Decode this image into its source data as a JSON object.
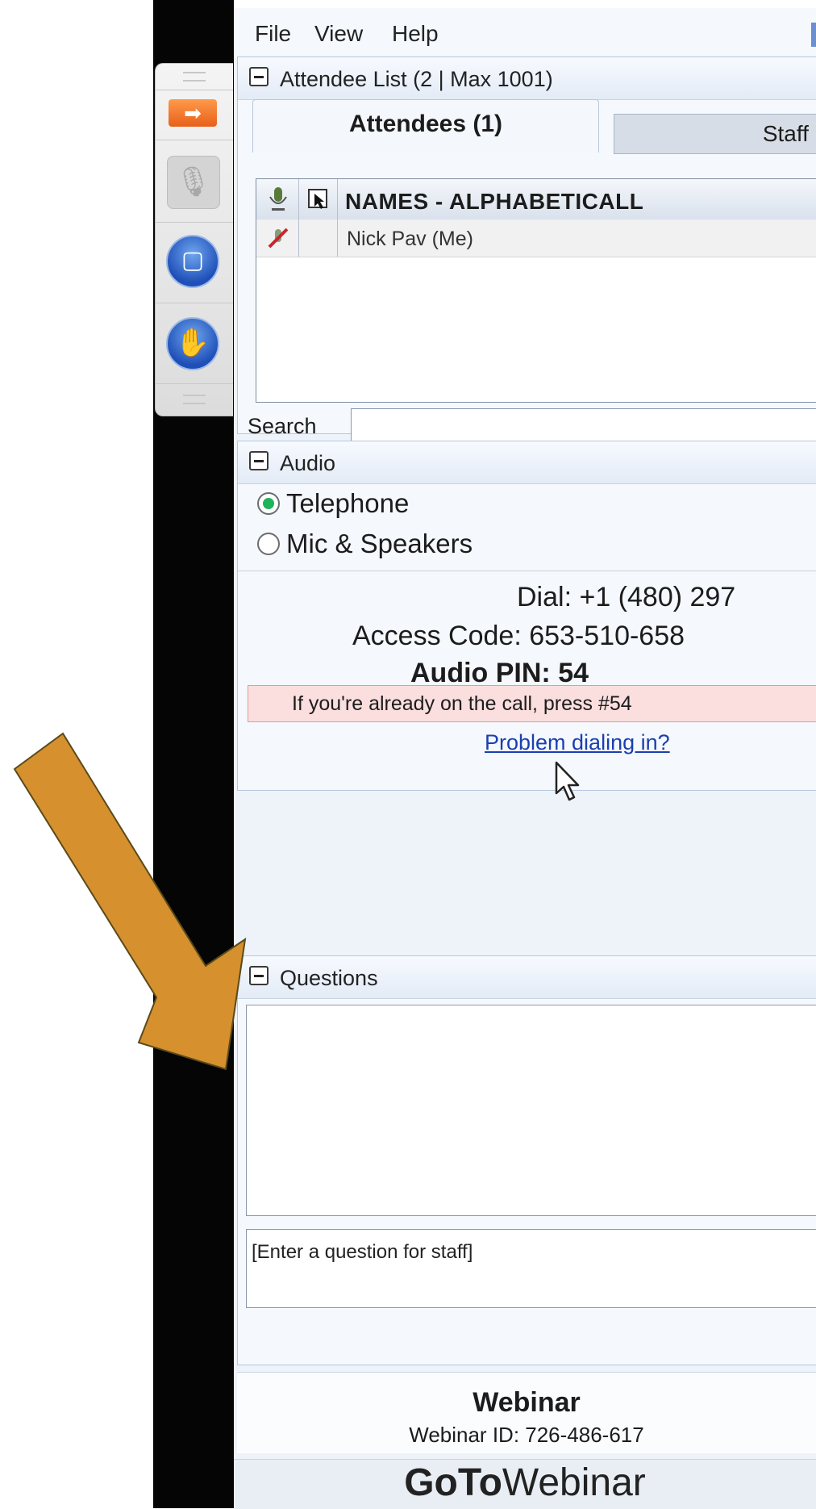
{
  "menu": {
    "file": "File",
    "view": "View",
    "help": "Help"
  },
  "attendee_panel": {
    "title": "Attendee List  (2 | Max 1001)",
    "tabs": {
      "attendees": "Attendees (1)",
      "staff": "Staff ("
    },
    "column_header": "NAMES - ALPHABETICALL",
    "rows": [
      {
        "name": "Nick Pav (Me)"
      }
    ],
    "search_label": "Search",
    "search_value": ""
  },
  "audio_panel": {
    "title": "Audio",
    "options": {
      "telephone": "Telephone",
      "mic_speakers": "Mic & Speakers"
    },
    "selected": "telephone",
    "dial": "Dial: +1 (480) 297",
    "access_code": "Access Code: 653-510-658",
    "audio_pin": "Audio PIN: 54",
    "alert": "If you're already on the call, press #54",
    "problem_link": "Problem dialing in?"
  },
  "questions_panel": {
    "title": "Questions",
    "input_placeholder": "[Enter a question for staff]"
  },
  "footer": {
    "title": "Webinar",
    "webinar_id": "Webinar ID: 726-486-617",
    "brand_bold": "GoTo",
    "brand_light": "Webinar"
  },
  "colors": {
    "arrow": "#D6902E",
    "accent_orange": "#E8601A",
    "link": "#1B3FB0",
    "alert_bg": "#FBDEDE"
  },
  "icons": [
    "orange-arrow-icon",
    "microphone-icon",
    "screen-icon",
    "raise-hand-icon",
    "mic-muted-icon",
    "webcam-icon",
    "mouse-cursor-icon",
    "annotation-arrow-icon"
  ]
}
